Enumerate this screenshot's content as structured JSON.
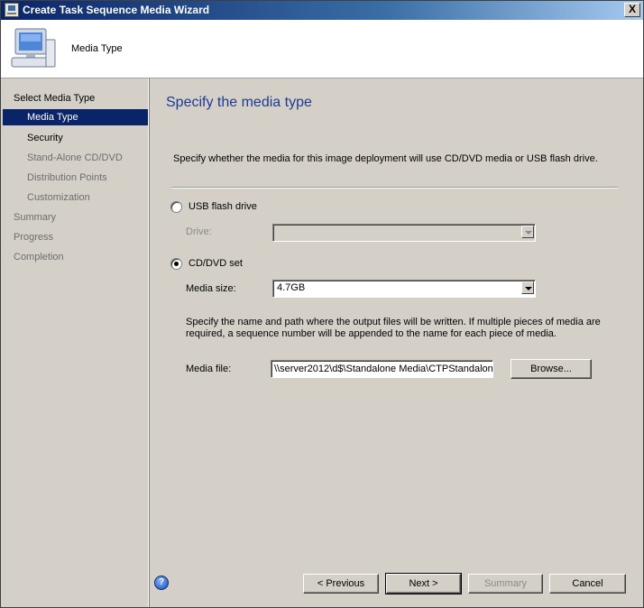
{
  "window": {
    "title": "Create Task Sequence Media Wizard",
    "close_label": "X"
  },
  "header": {
    "title": "Media Type"
  },
  "sidebar": {
    "items": [
      {
        "label": "Select Media Type",
        "state": "normal"
      },
      {
        "label": "Media Type",
        "state": "selected"
      },
      {
        "label": "Security",
        "state": "normal"
      },
      {
        "label": "Stand-Alone CD/DVD",
        "state": "dim"
      },
      {
        "label": "Distribution Points",
        "state": "dim"
      },
      {
        "label": "Customization",
        "state": "dim"
      },
      {
        "label": "Summary",
        "state": "dim"
      },
      {
        "label": "Progress",
        "state": "dim"
      },
      {
        "label": "Completion",
        "state": "dim"
      }
    ]
  },
  "main": {
    "heading": "Specify the media type",
    "description": "Specify whether the media for this image deployment will use CD/DVD media or USB flash drive.",
    "usb": {
      "label": "USB flash drive",
      "selected": false,
      "drive_label": "Drive:",
      "drive_value": ""
    },
    "cddvd": {
      "label": "CD/DVD set",
      "selected": true,
      "media_size_label": "Media size:",
      "media_size_value": "4.7GB",
      "info_line1": "Specify the name and path where the output files will be written.  If multiple pieces of media are",
      "info_line2": "required, a sequence number will be appended to the name for each piece of media.",
      "media_file_label": "Media file:",
      "media_file_value": "\\\\server2012\\d$\\Standalone Media\\CTPStandalon",
      "browse_label": "Browse..."
    }
  },
  "footer": {
    "help_label": "?",
    "previous_label": "< Previous",
    "next_label": "Next >",
    "summary_label": "Summary",
    "cancel_label": "Cancel"
  }
}
